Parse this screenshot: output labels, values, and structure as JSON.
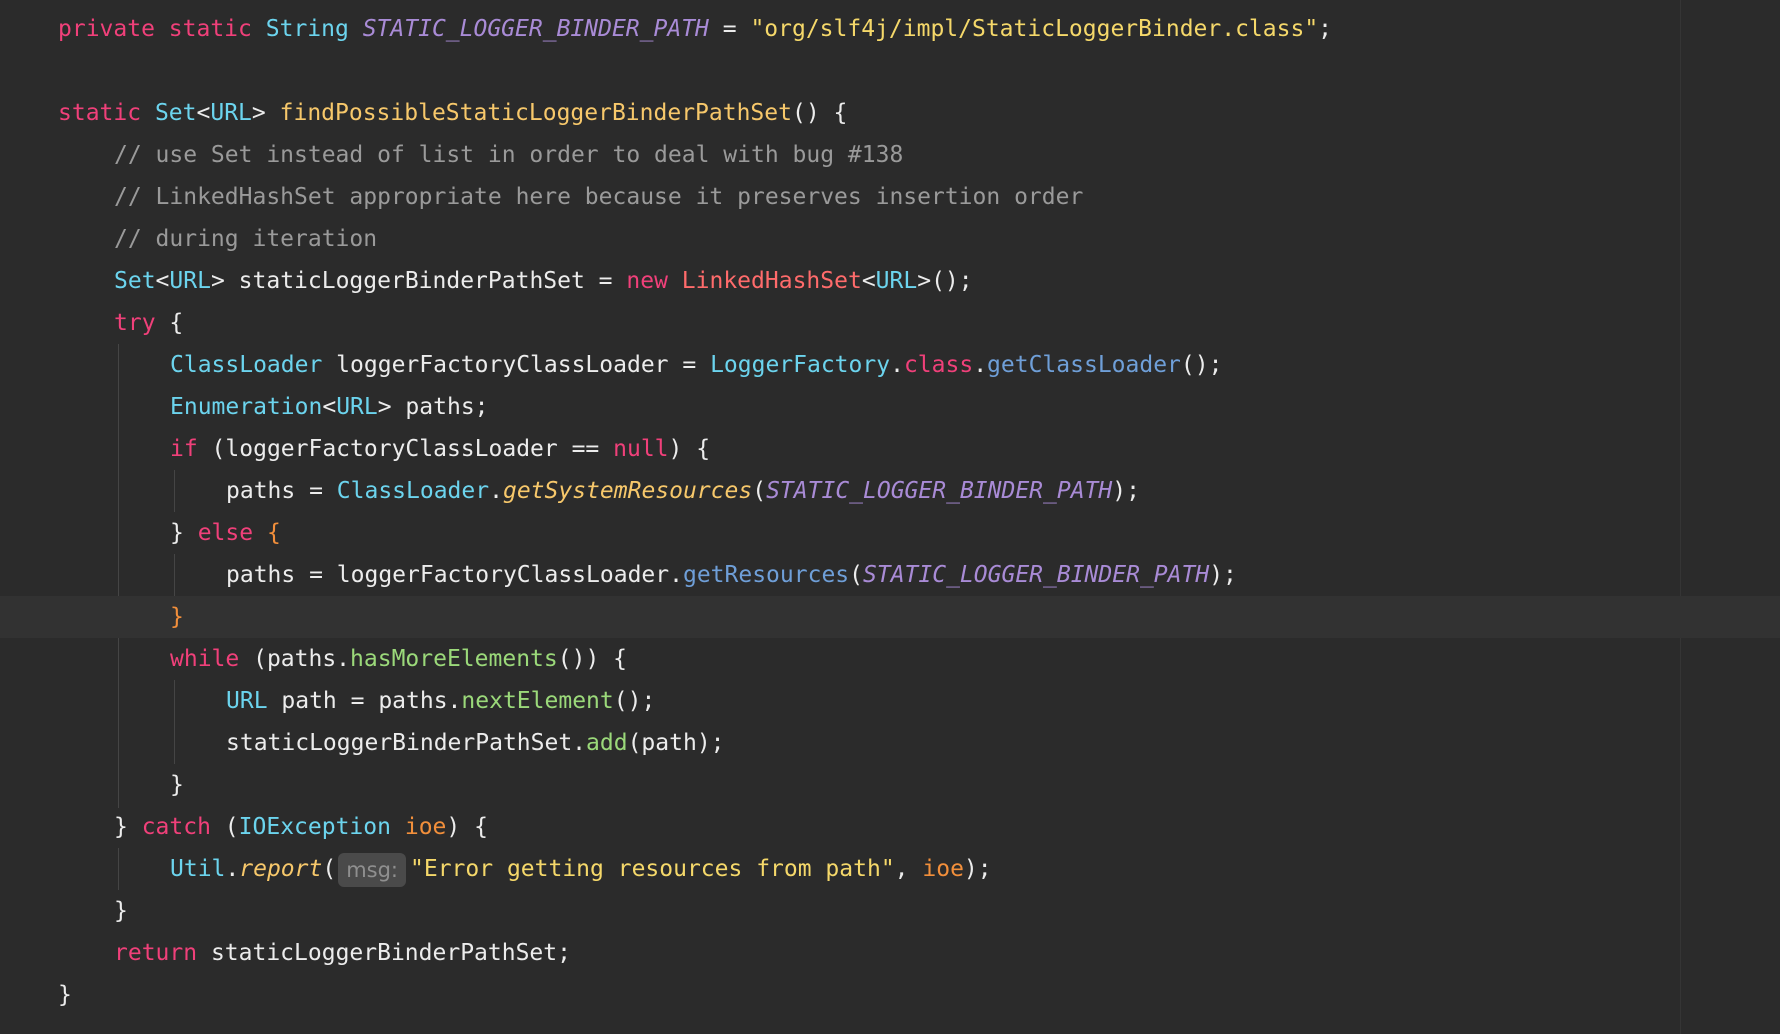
{
  "colors": {
    "background": "#2b2b2b",
    "keyword": "#f0407a",
    "type": "#6cd4ee",
    "constant": "#a98bd6",
    "string": "#f5d86a",
    "comment": "#9a9a9a"
  },
  "code": {
    "line1": {
      "kw_private": "private",
      "kw_static": "static",
      "type_string": "String",
      "const_name": "STATIC_LOGGER_BINDER_PATH",
      "op_assign": " = ",
      "str_value": "\"org/slf4j/impl/StaticLoggerBinder.class\"",
      "semi": ";"
    },
    "line3": {
      "kw_static": "static",
      "type_set": "Set",
      "gen_open": "<",
      "type_url": "URL",
      "gen_close": ">",
      "method_name": "findPossibleStaticLoggerBinderPathSet",
      "rest": "() {"
    },
    "line4": {
      "comment": "// use Set instead of list in order to deal with bug #138"
    },
    "line5": {
      "comment": "// LinkedHashSet appropriate here because it preserves insertion order"
    },
    "line6": {
      "comment": "// during iteration"
    },
    "line7": {
      "type_set": "Set",
      "gen_open": "<",
      "type_url": "URL",
      "gen_close": ">",
      "var": " staticLoggerBinderPathSet = ",
      "kw_new": "new",
      "cls_lhs": "LinkedHashSet",
      "gen_open2": "<",
      "type_url2": "URL",
      "rest": ">();"
    },
    "line8": {
      "kw_try": "try",
      "rest": " {"
    },
    "line9": {
      "type_classloader": "ClassLoader",
      "var": " loggerFactoryClassLoader = ",
      "type_loggerfactory": "LoggerFactory",
      "dot1": ".",
      "kw_class": "class",
      "dot2": ".",
      "call": "getClassLoader",
      "rest": "();"
    },
    "line10": {
      "type_enum": "Enumeration",
      "gen_open": "<",
      "type_url": "URL",
      "rest": "> paths;"
    },
    "line11": {
      "kw_if": "if",
      "mid": " (loggerFactoryClassLoader == ",
      "kw_null": "null",
      "rest": ") {"
    },
    "line12": {
      "lhs": "paths = ",
      "type_classloader": "ClassLoader",
      "dot": ".",
      "call": "getSystemResources",
      "open": "(",
      "const_name": "STATIC_LOGGER_BINDER_PATH",
      "rest": ");"
    },
    "line13": {
      "close": "} ",
      "kw_else": "else",
      "brace": " {"
    },
    "line14": {
      "lhs": "paths = loggerFactoryClassLoader.",
      "call": "getResources",
      "open": "(",
      "const_name": "STATIC_LOGGER_BINDER_PATH",
      "rest": ");"
    },
    "line15": {
      "brace": "}"
    },
    "line16": {
      "kw_while": "while",
      "mid": " (paths.",
      "call": "hasMoreElements",
      "rest": "()) {"
    },
    "line17": {
      "type_url": "URL",
      "mid": " path = paths.",
      "call": "nextElement",
      "rest": "();"
    },
    "line18": {
      "lhs": "staticLoggerBinderPathSet.",
      "call": "add",
      "rest": "(path);"
    },
    "line19": {
      "brace": "}"
    },
    "line20": {
      "close": "} ",
      "kw_catch": "catch",
      "open": " (",
      "type_ioexception": "IOException",
      "sp": " ",
      "param": "ioe",
      "rest": ") {"
    },
    "line21": {
      "type_util": "Util",
      "dot": ".",
      "call": "report",
      "open": "(",
      "hint": "msg:",
      "str_value": "\"Error getting resources from path\"",
      "comma": ", ",
      "param": "ioe",
      "rest": ");"
    },
    "line22": {
      "brace": "}"
    },
    "line23": {
      "kw_return": "return",
      "rest": " staticLoggerBinderPathSet;"
    },
    "line24": {
      "brace": "}"
    }
  }
}
